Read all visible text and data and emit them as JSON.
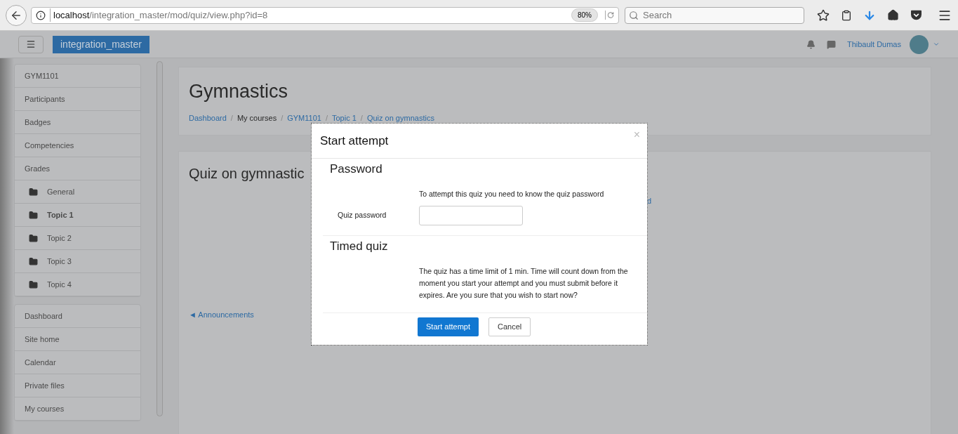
{
  "browser": {
    "url_host": "localhost",
    "url_path": "/integration_master/mod/quiz/view.php?id=8",
    "zoom": "80%",
    "search_placeholder": "Search"
  },
  "navbar": {
    "site_name": "integration_master",
    "user_name": "Thibault Dumas"
  },
  "sidebar": {
    "groups": [
      {
        "items": [
          {
            "label": "GYM1101",
            "kind": "plain",
            "selected": false
          },
          {
            "label": "Participants",
            "kind": "plain",
            "selected": false
          },
          {
            "label": "Badges",
            "kind": "plain",
            "selected": false
          },
          {
            "label": "Competencies",
            "kind": "plain",
            "selected": false
          },
          {
            "label": "Grades",
            "kind": "plain",
            "selected": false
          },
          {
            "label": "General",
            "kind": "folder",
            "selected": false
          },
          {
            "label": "Topic 1",
            "kind": "folder",
            "selected": true
          },
          {
            "label": "Topic 2",
            "kind": "folder",
            "selected": false
          },
          {
            "label": "Topic 3",
            "kind": "folder",
            "selected": false
          },
          {
            "label": "Topic 4",
            "kind": "folder",
            "selected": false
          }
        ]
      },
      {
        "items": [
          {
            "label": "Dashboard",
            "kind": "plain",
            "selected": false
          },
          {
            "label": "Site home",
            "kind": "plain",
            "selected": false
          },
          {
            "label": "Calendar",
            "kind": "plain",
            "selected": false
          },
          {
            "label": "Private files",
            "kind": "plain",
            "selected": false
          },
          {
            "label": "My courses",
            "kind": "plain",
            "selected": false
          }
        ]
      }
    ]
  },
  "header": {
    "title": "Gymnastics",
    "separator": "/",
    "breadcrumbs": [
      {
        "label": "Dashboard",
        "link": true
      },
      {
        "label": "My courses",
        "link": false
      },
      {
        "label": "GYM1101",
        "link": true
      },
      {
        "label": "Topic 1",
        "link": true
      },
      {
        "label": "Quiz on gymnastics",
        "link": true
      }
    ]
  },
  "content": {
    "title": "Quiz on gymnastic",
    "hidden_link_fragment": "d",
    "prev_link": "◄ Announcements"
  },
  "dialog": {
    "title": "Start attempt",
    "close": "×",
    "sections": [
      {
        "heading": "Password",
        "text": "To attempt this quiz you need to know the quiz password",
        "field_label": "Quiz password"
      },
      {
        "heading": "Timed quiz",
        "text": "The quiz has a time limit of 1 min. Time will count down from the moment you start your attempt and you must submit before it expires. Are you sure that you wish to start now?"
      }
    ],
    "buttons": [
      {
        "label": "Start attempt",
        "primary": true
      },
      {
        "label": "Cancel",
        "primary": false
      }
    ]
  }
}
